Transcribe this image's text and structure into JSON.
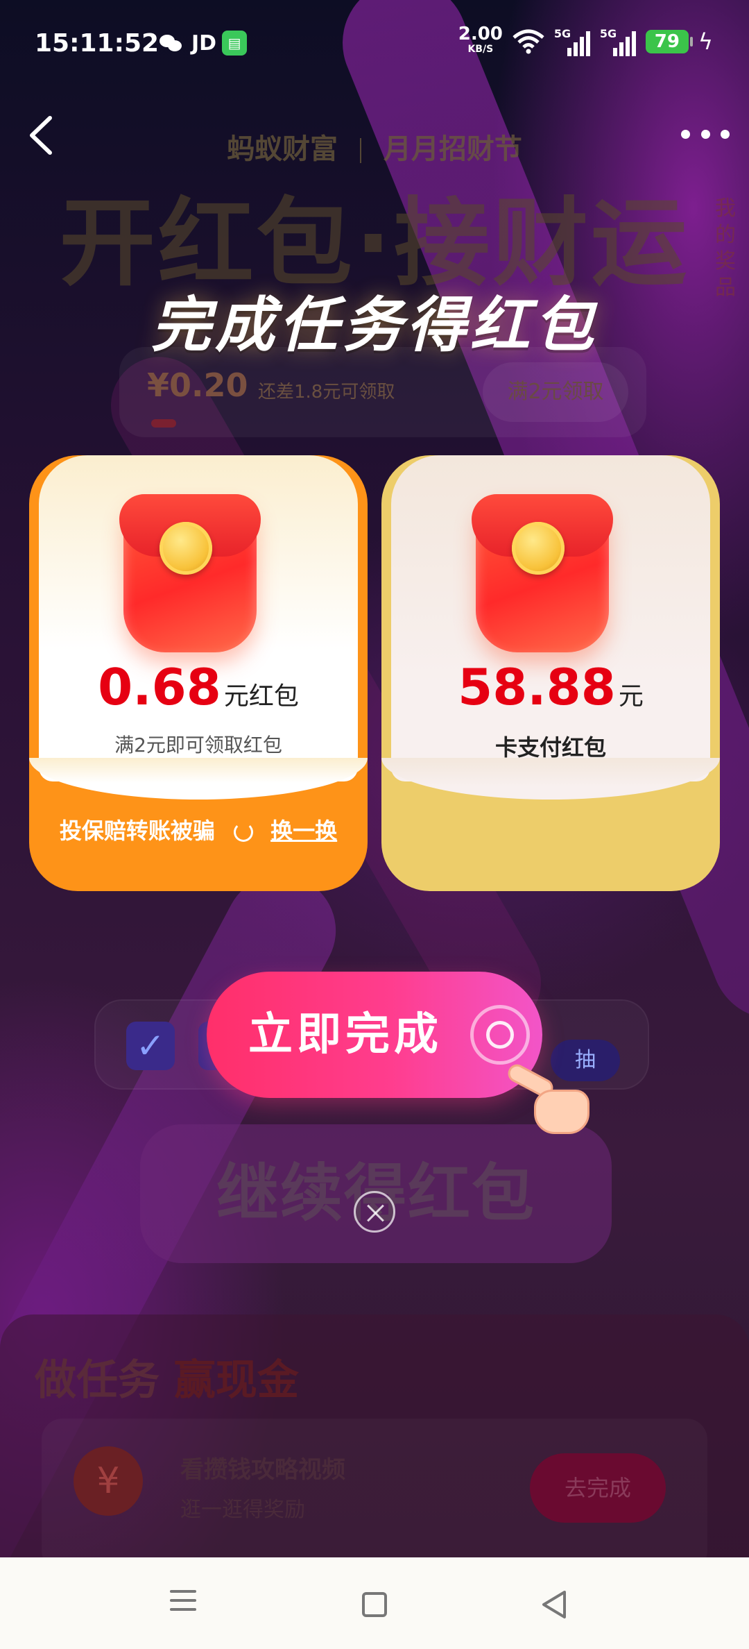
{
  "status_bar": {
    "time": "15:11:52",
    "app_jd": "JD",
    "net_speed": "2.00",
    "net_speed_unit": "KB/S",
    "sim1": "5G",
    "sim2": "5G",
    "battery": "79"
  },
  "background": {
    "brand": "蚂蚁财富",
    "campaign": "月月招财节",
    "headline": "开红包·接财运",
    "my_prizes": "我的奖品",
    "progress_amount": "¥0.20",
    "progress_hint": "还差1.8元可领取",
    "progress_button": "满2元领取",
    "draw_label": "抽",
    "continue_label": "继续得红包",
    "task_section_title": "做任务",
    "task_section_title_hl": "赢现金",
    "task_item_name": "看攒钱攻略视频",
    "task_item_sub": "逛一逛得奖励",
    "task_item_button": "去完成"
  },
  "modal": {
    "title": "完成任务得红包",
    "card_left": {
      "amount": "0.68",
      "unit": "元红包",
      "desc": "满2元即可领取红包",
      "bottom_text": "投保赔转账被骗",
      "swap_label": "换一换"
    },
    "card_right": {
      "amount": "58.88",
      "unit": "元",
      "desc": "卡支付红包"
    },
    "cta_label": "立即完成"
  },
  "colors": {
    "accent_red": "#e60012",
    "card_orange": "#fe9318",
    "card_gold": "#edcd6a",
    "cta_pink": "#ff3d8e"
  }
}
